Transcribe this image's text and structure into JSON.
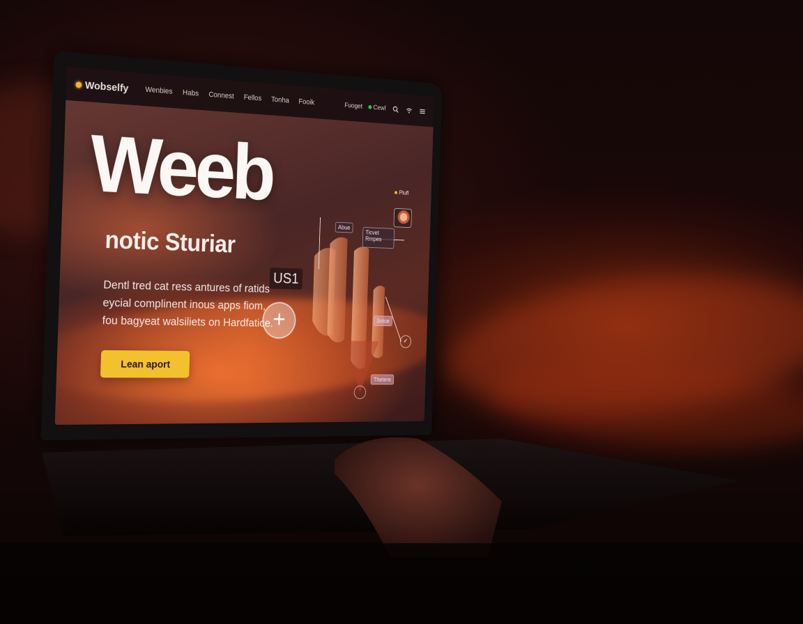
{
  "site": {
    "logo_text": "Wobselfy"
  },
  "nav": {
    "links": [
      "Wenbies",
      "Habs",
      "Connest",
      "Fellos",
      "Tonha",
      "Fooik"
    ],
    "extra": "Fuoget",
    "status_label": "Cewl"
  },
  "hero": {
    "title": "Weeb",
    "subtitle": "notic Sturiar",
    "badge": "US1",
    "description": [
      "Dentl tred cat ress antures of ratids",
      "eycial complinent inous apps fiom,",
      "fou bagyeat walsiliets on Hardfatice."
    ],
    "cta_label": "Lean aport",
    "plus_symbol": "+"
  },
  "illustration": {
    "user_label": "Plufl",
    "tag_1": "Abue",
    "tag_2": "Ticvet Rmpes",
    "tag_3": "Sotce",
    "tag_4": "Thetere"
  },
  "colors": {
    "accent": "#f4c12e",
    "status": "#2ec25a",
    "glow": "#e8662c"
  },
  "icons": {
    "search": "search-icon",
    "wifi": "wifi-icon",
    "menu": "menu-icon"
  }
}
